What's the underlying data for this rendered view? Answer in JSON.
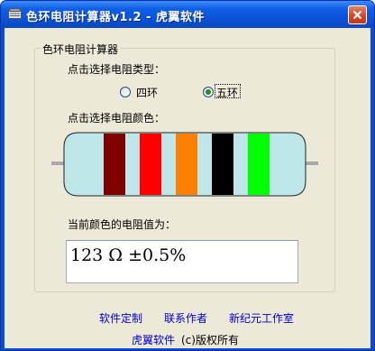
{
  "window": {
    "title": "色环电阻计算器v1.2 - 虎翼软件",
    "close_icon": "close-x-icon",
    "app_icon": "app-calculator-icon"
  },
  "group": {
    "label": "色环电阻计算器",
    "type_prompt": "点击选择电阻类型：",
    "options": [
      {
        "label": "四环",
        "checked": false
      },
      {
        "label": "五环",
        "checked": true
      }
    ],
    "color_prompt": "点击选择电阻颜色：",
    "bands": [
      {
        "color": "#800000"
      },
      {
        "color": "#ff0000"
      },
      {
        "color": "#ff8000"
      },
      {
        "color": "#000000"
      },
      {
        "color": "#00ff00"
      }
    ],
    "body_color": "#bfe6e9",
    "value_prompt": "当前颜色的电阻值为：",
    "value": "123 Ω ±0.5%"
  },
  "footer": {
    "links": [
      "软件定制",
      "联系作者",
      "新纪元工作室"
    ],
    "brand_link": "虎翼软件",
    "copyright": "(c)版权所有"
  }
}
